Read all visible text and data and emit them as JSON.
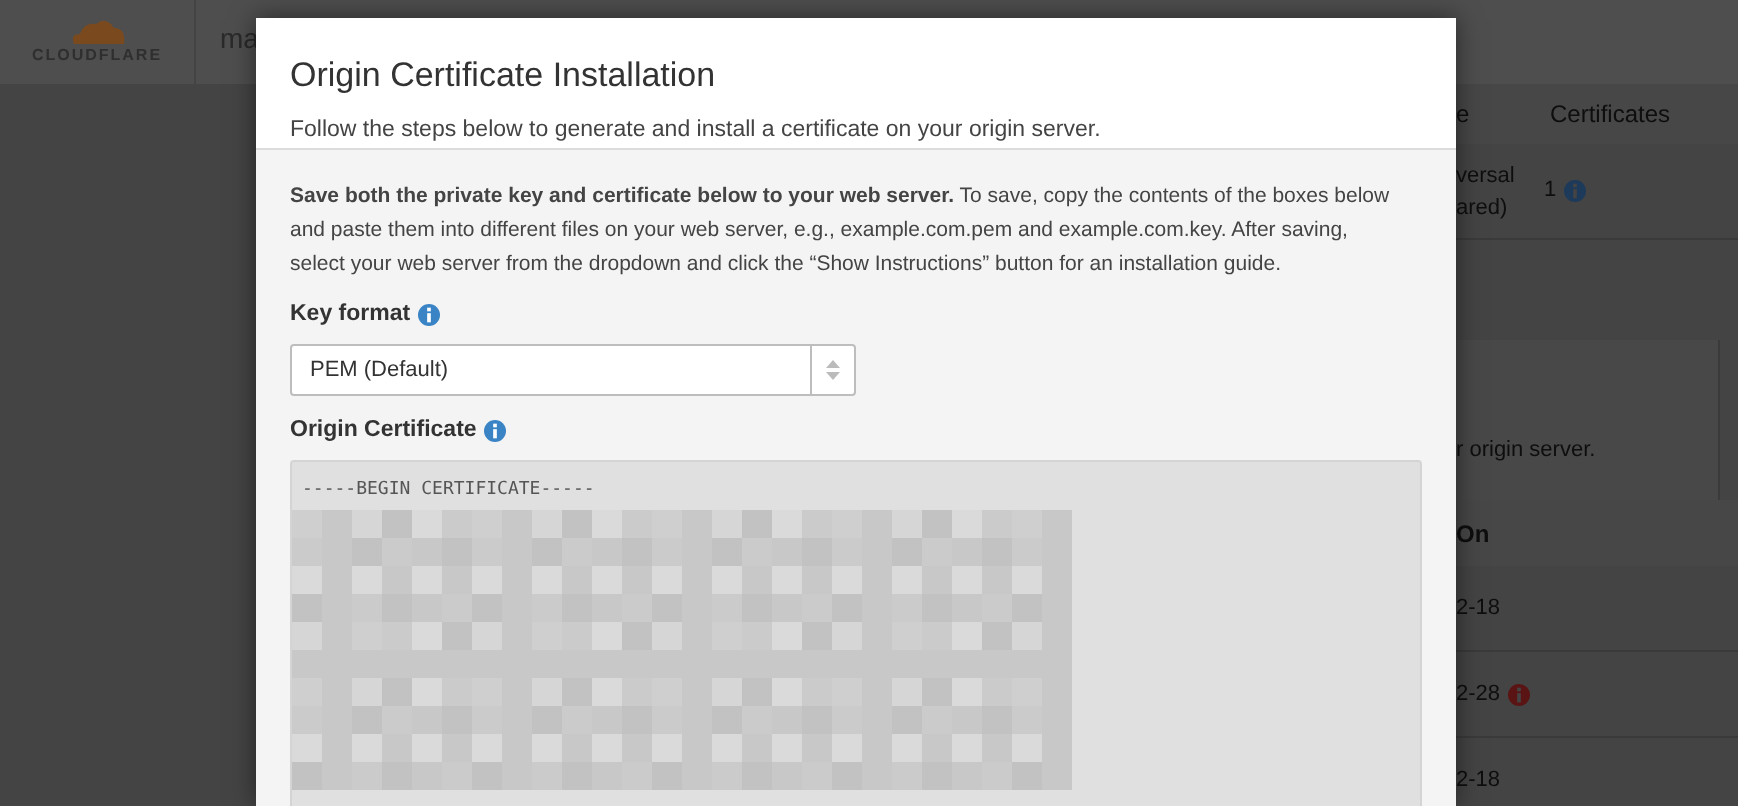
{
  "app_header": {
    "logo": "CLOUDFLARE",
    "zone": "ma"
  },
  "background_table": {
    "columns": [
      "e",
      "Certificates"
    ],
    "row": {
      "type": [
        "versal",
        "ared)"
      ],
      "certificates": "1"
    }
  },
  "background_panel": {
    "text": "r origin server."
  },
  "background_list": {
    "column": "On",
    "rows": [
      {
        "date": "2-18",
        "warning": false
      },
      {
        "date": "2-28",
        "warning": true
      },
      {
        "date": "2-18",
        "warning": false
      }
    ]
  },
  "modal": {
    "title": "Origin Certificate Installation",
    "subtitle": "Follow the steps below to generate and install a certificate on your origin server.",
    "instructions": "**Save both the private key and certificate below to your web server.** To save, copy the contents of the boxes below and paste them into different files on your web server, e.g., example.com.pem and example.com.key. After saving, select your web server from the dropdown and click the “Show Instructions” button for an installation guide.",
    "key_format": {
      "label": "Key format",
      "value": "PEM (Default)"
    },
    "certificate": {
      "label": "Origin Certificate",
      "first_line": "-----BEGIN CERTIFICATE-----"
    }
  }
}
